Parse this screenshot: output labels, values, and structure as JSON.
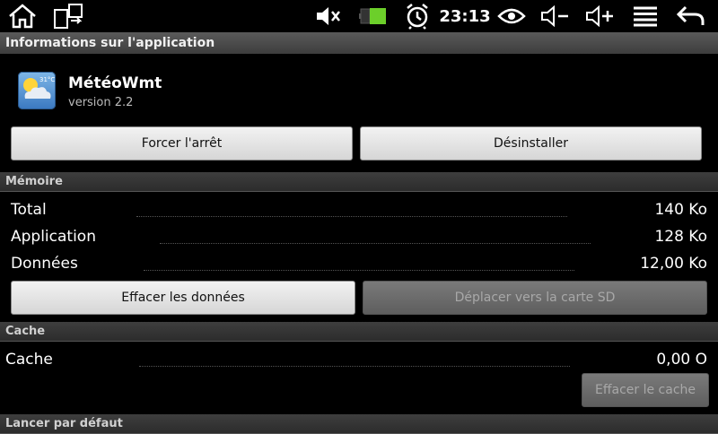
{
  "status_bar": {
    "icons": [
      "home-icon",
      "screen-rotate-icon",
      "mute-icon",
      "battery-icon",
      "alarm-icon",
      "eye-icon",
      "volume-down-icon",
      "volume-up-icon",
      "menu-icon",
      "back-icon"
    ],
    "time": "23:13",
    "battery_color": "#6ccf2a"
  },
  "title": "Informations sur l'application",
  "app": {
    "name": "MétéoWmt",
    "version": "version 2.2",
    "icon_temp": "31°C"
  },
  "actions": {
    "force_stop": "Forcer l'arrêt",
    "uninstall": "Désinstaller"
  },
  "memory": {
    "header": "Mémoire",
    "rows": [
      {
        "label": "Total",
        "value": "140 Ko"
      },
      {
        "label": "Application",
        "value": "128 Ko"
      },
      {
        "label": "Données",
        "value": "12,00 Ko"
      }
    ],
    "clear_data": "Effacer les données",
    "move_sd": "Déplacer vers la carte SD"
  },
  "cache": {
    "header": "Cache",
    "label": "Cache",
    "value": "0,00 O",
    "clear_cache": "Effacer le cache"
  },
  "defaults": {
    "header": "Lancer par défaut"
  }
}
